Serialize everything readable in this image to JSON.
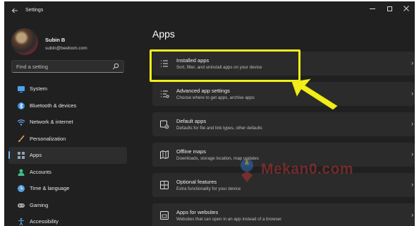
{
  "window": {
    "title": "Settings"
  },
  "profile": {
    "name": "Subin B",
    "email": "subin@beebom.com"
  },
  "search": {
    "placeholder": "Find a setting"
  },
  "sidebar": {
    "items": [
      {
        "label": "System",
        "icon": "monitor-icon",
        "color": "#4da3f0",
        "active": false
      },
      {
        "label": "Bluetooth & devices",
        "icon": "bluetooth-icon",
        "color": "#3a8de0",
        "active": false
      },
      {
        "label": "Network & internet",
        "icon": "wifi-icon",
        "color": "#6aa7e8",
        "active": false
      },
      {
        "label": "Personalization",
        "icon": "brush-icon",
        "color": "#e6a15a",
        "active": false
      },
      {
        "label": "Apps",
        "icon": "apps-icon",
        "color": "#8fa3b8",
        "active": true
      },
      {
        "label": "Accounts",
        "icon": "person-icon",
        "color": "#3fc08a",
        "active": false
      },
      {
        "label": "Time & language",
        "icon": "globe-clock-icon",
        "color": "#58a0e0",
        "active": false
      },
      {
        "label": "Gaming",
        "icon": "gamepad-icon",
        "color": "#a6a6a6",
        "active": false
      },
      {
        "label": "Accessibility",
        "icon": "accessibility-icon",
        "color": "#5aa8f0",
        "active": false
      }
    ]
  },
  "main": {
    "title": "Apps",
    "cards": [
      {
        "title": "Installed apps",
        "subtitle": "Sort, filter, and uninstall apps on your device",
        "icon": "list-icon"
      },
      {
        "title": "Advanced app settings",
        "subtitle": "Choose where to get apps, archive apps",
        "icon": "list-settings-icon"
      },
      {
        "title": "Default apps",
        "subtitle": "Defaults for file and link types, other defaults",
        "icon": "default-apps-icon"
      },
      {
        "title": "Offline maps",
        "subtitle": "Downloads, storage location, map updates",
        "icon": "map-icon"
      },
      {
        "title": "Optional features",
        "subtitle": "Extra functionality for your device",
        "icon": "add-features-icon"
      },
      {
        "title": "Apps for websites",
        "subtitle": "Websites that can open in an app instead of a browser",
        "icon": "web-app-icon"
      }
    ]
  },
  "watermark": {
    "text": "Mekan0.com"
  },
  "colors": {
    "highlight": "#f2ee1a",
    "accent": "#6cb8f6",
    "background": "#202020",
    "card": "#2b2b2b"
  }
}
